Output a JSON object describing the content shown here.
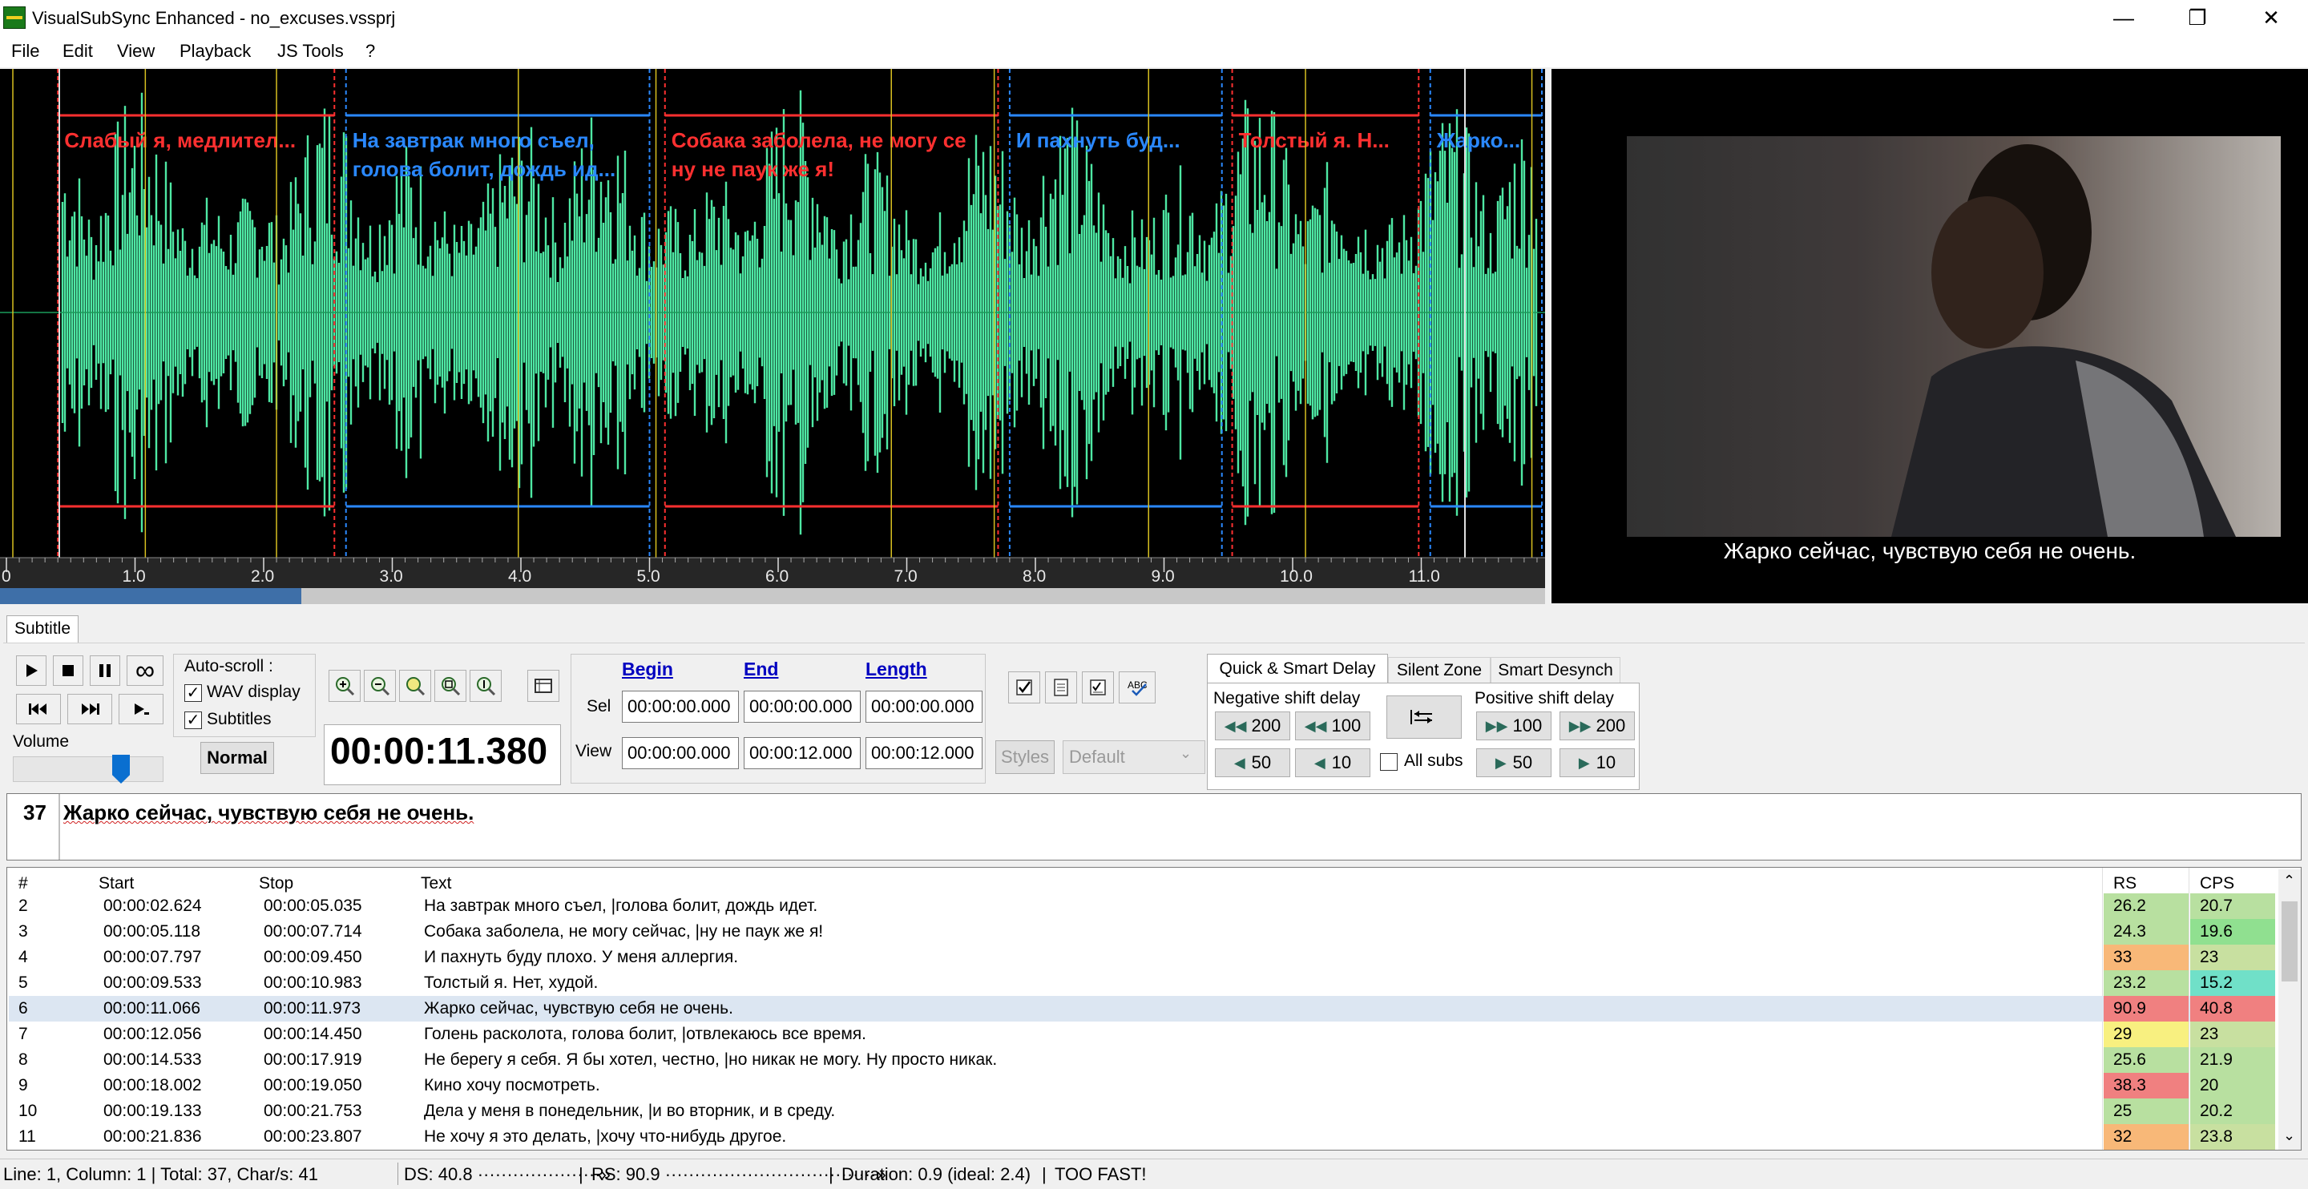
{
  "window": {
    "title": "VisualSubSync Enhanced - no_excuses.vssprj"
  },
  "menu": [
    "File",
    "Edit",
    "View",
    "Playback",
    "JS Tools",
    "?"
  ],
  "waveform": {
    "ticks": [
      "0",
      "1.0",
      "2.0",
      "3.0",
      "4.0",
      "5.0",
      "6.0",
      "7.0",
      "8.0",
      "9.0",
      "10.0",
      "11.0"
    ],
    "subs": [
      {
        "line1": "Слабый я, медлител...",
        "line2": "",
        "color": "#ff3030"
      },
      {
        "line1": "На завтрак много съел,",
        "line2": "голова болит, дождь ид...",
        "color": "#2a88ff"
      },
      {
        "line1": "Собака заболела, не могу се",
        "line2": "ну не паук же я!",
        "color": "#ff3030"
      },
      {
        "line1": "И пахнуть буд...",
        "line2": "",
        "color": "#2a88ff"
      },
      {
        "line1": "Толстый я. Н...",
        "line2": "",
        "color": "#ff3030"
      },
      {
        "line1": "Жарко...",
        "line2": "",
        "color": "#2a88ff"
      }
    ],
    "wave_color": "#4ee8a4"
  },
  "video": {
    "subtitle": "Жарко сейчас, чувствую себя не очень."
  },
  "tabs": {
    "subtitle": "Subtitle"
  },
  "controls": {
    "volume_label": "Volume",
    "autoscroll_label": "Auto-scroll :",
    "wav_display_label": "WAV display",
    "subtitles_label": "Subtitles",
    "speed_label": "Normal",
    "time": "00:00:11.380",
    "begin_label": "Begin",
    "end_label": "End",
    "length_label": "Length",
    "sel_label": "Sel",
    "view_label": "View",
    "sel_begin": "00:00:00.000",
    "sel_end": "00:00:00.000",
    "sel_length": "00:00:00.000",
    "view_begin": "00:00:00.000",
    "view_end": "00:00:12.000",
    "view_length": "00:00:12.000",
    "styles_label": "Styles",
    "style_value": "Default"
  },
  "delay": {
    "tabs": [
      "Quick & Smart Delay",
      "Silent Zone",
      "Smart Desynch"
    ],
    "negative_label": "Negative shift delay",
    "positive_label": "Positive shift delay",
    "neg_buttons": [
      "200",
      "100",
      "50",
      "10"
    ],
    "pos_buttons": [
      "100",
      "200",
      "50",
      "10"
    ],
    "all_subs_label": "All subs"
  },
  "editor": {
    "index": "37",
    "text": "Жарко сейчас, чувствую себя не очень."
  },
  "table": {
    "headers": {
      "num": "#",
      "start": "Start",
      "stop": "Stop",
      "text": "Text",
      "rs": "RS",
      "cps": "CPS"
    },
    "rows": [
      {
        "num": "2",
        "start": "00:00:02.624",
        "stop": "00:00:05.035",
        "text": "На завтрак много съел, |голова болит, дождь идет.",
        "rs": "26.2",
        "cps": "20.7",
        "rs_color": "#b8e0a0",
        "cps_color": "#b8e0a0"
      },
      {
        "num": "3",
        "start": "00:00:05.118",
        "stop": "00:00:07.714",
        "text": "Собака заболела, не могу сейчас, |ну не паук же я!",
        "rs": "24.3",
        "cps": "19.6",
        "rs_color": "#b8e0a0",
        "cps_color": "#90e090"
      },
      {
        "num": "4",
        "start": "00:00:07.797",
        "stop": "00:00:09.450",
        "text": "И пахнуть буду плохо. У меня аллергия.",
        "rs": "33",
        "cps": "23",
        "rs_color": "#f8b878",
        "cps_color": "#c8e0a0"
      },
      {
        "num": "5",
        "start": "00:00:09.533",
        "stop": "00:00:10.983",
        "text": "Толстый я. Нет, худой.",
        "rs": "23.2",
        "cps": "15.2",
        "rs_color": "#b8e0a0",
        "cps_color": "#70e0c8"
      },
      {
        "num": "6",
        "start": "00:00:11.066",
        "stop": "00:00:11.973",
        "text": "Жарко сейчас, чувствую себя не очень.",
        "rs": "90.9",
        "cps": "40.8",
        "rs_color": "#f08080",
        "cps_color": "#f08080"
      },
      {
        "num": "7",
        "start": "00:00:12.056",
        "stop": "00:00:14.450",
        "text": "Голень расколота, голова болит, |отвлекаюсь все время.",
        "rs": "29",
        "cps": "23",
        "rs_color": "#f8f080",
        "cps_color": "#c8e0a0"
      },
      {
        "num": "8",
        "start": "00:00:14.533",
        "stop": "00:00:17.919",
        "text": "Не берегу я себя. Я бы хотел, честно, |но никак не могу. Ну просто никак.",
        "rs": "25.6",
        "cps": "21.9",
        "rs_color": "#b8e0a0",
        "cps_color": "#b8e0a0"
      },
      {
        "num": "9",
        "start": "00:00:18.002",
        "stop": "00:00:19.050",
        "text": "Кино хочу посмотреть.",
        "rs": "38.3",
        "cps": "20",
        "rs_color": "#f08080",
        "cps_color": "#b8e0a0"
      },
      {
        "num": "10",
        "start": "00:00:19.133",
        "stop": "00:00:21.753",
        "text": "Дела у меня в понедельник, |и во вторник, и в среду.",
        "rs": "25",
        "cps": "20.2",
        "rs_color": "#b8e0a0",
        "cps_color": "#b8e0a0"
      },
      {
        "num": "11",
        "start": "00:00:21.836",
        "stop": "00:00:23.807",
        "text": "Не хочу я это делать, |хочу что-нибудь другое.",
        "rs": "32",
        "cps": "23.8",
        "rs_color": "#f8b878",
        "cps_color": "#c8e0a0"
      }
    ]
  },
  "status": {
    "position": "Line: 1, Column: 1 | Total: 37, Char/s: 41",
    "ds": "DS: 40.8 ·····················»",
    "rs": "RS: 90.9 ····································»",
    "duration": "Duration: 0.9 (ideal: 2.4)",
    "warning": "TOO FAST!"
  }
}
